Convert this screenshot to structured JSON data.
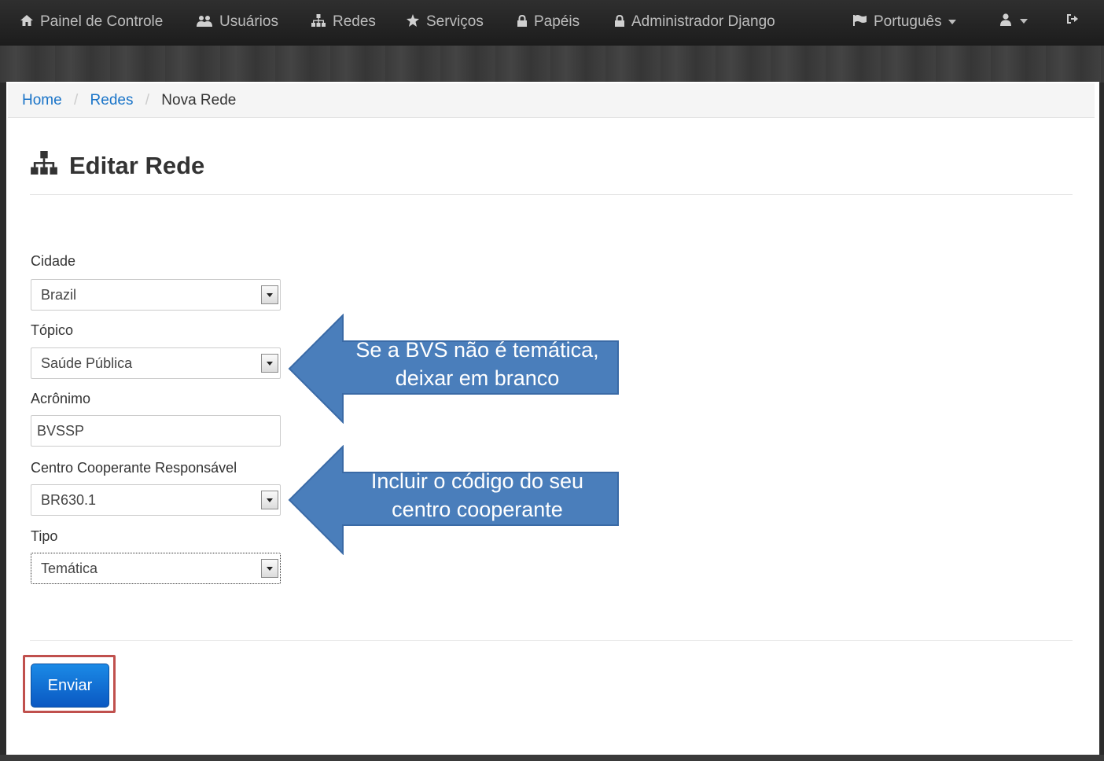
{
  "navbar": {
    "items": [
      {
        "label": "Painel de Controle",
        "icon": "home-icon"
      },
      {
        "label": "Usuários",
        "icon": "users-icon"
      },
      {
        "label": "Redes",
        "icon": "sitemap-icon"
      },
      {
        "label": "Serviços",
        "icon": "star-icon"
      },
      {
        "label": "Papéis",
        "icon": "lock-icon"
      },
      {
        "label": "Administrador Django",
        "icon": "lock-icon"
      }
    ],
    "language": "Português",
    "language_icon": "flag-icon",
    "user_icon": "user-icon",
    "logout_icon": "logout-icon"
  },
  "breadcrumb": {
    "home": "Home",
    "redes": "Redes",
    "current": "Nova Rede"
  },
  "page": {
    "title": "Editar Rede",
    "title_icon": "sitemap-icon"
  },
  "form": {
    "cidade": {
      "label": "Cidade",
      "value": "Brazil"
    },
    "topico": {
      "label": "Tópico",
      "value": "Saúde Pública"
    },
    "acronimo": {
      "label": "Acrônimo",
      "value": "BVSSP"
    },
    "centro": {
      "label": "Centro Cooperante Responsável",
      "value": "BR630.1"
    },
    "tipo": {
      "label": "Tipo",
      "value": "Temática"
    },
    "submit_label": "Enviar"
  },
  "callouts": {
    "first": {
      "line1": "Se a BVS não é temática,",
      "line2": "deixar em branco"
    },
    "second": {
      "line1": "Incluir o código do seu",
      "line2": "centro cooperante"
    },
    "fill_color": "#4a7ebb",
    "stroke_color": "#3a6aa6"
  }
}
